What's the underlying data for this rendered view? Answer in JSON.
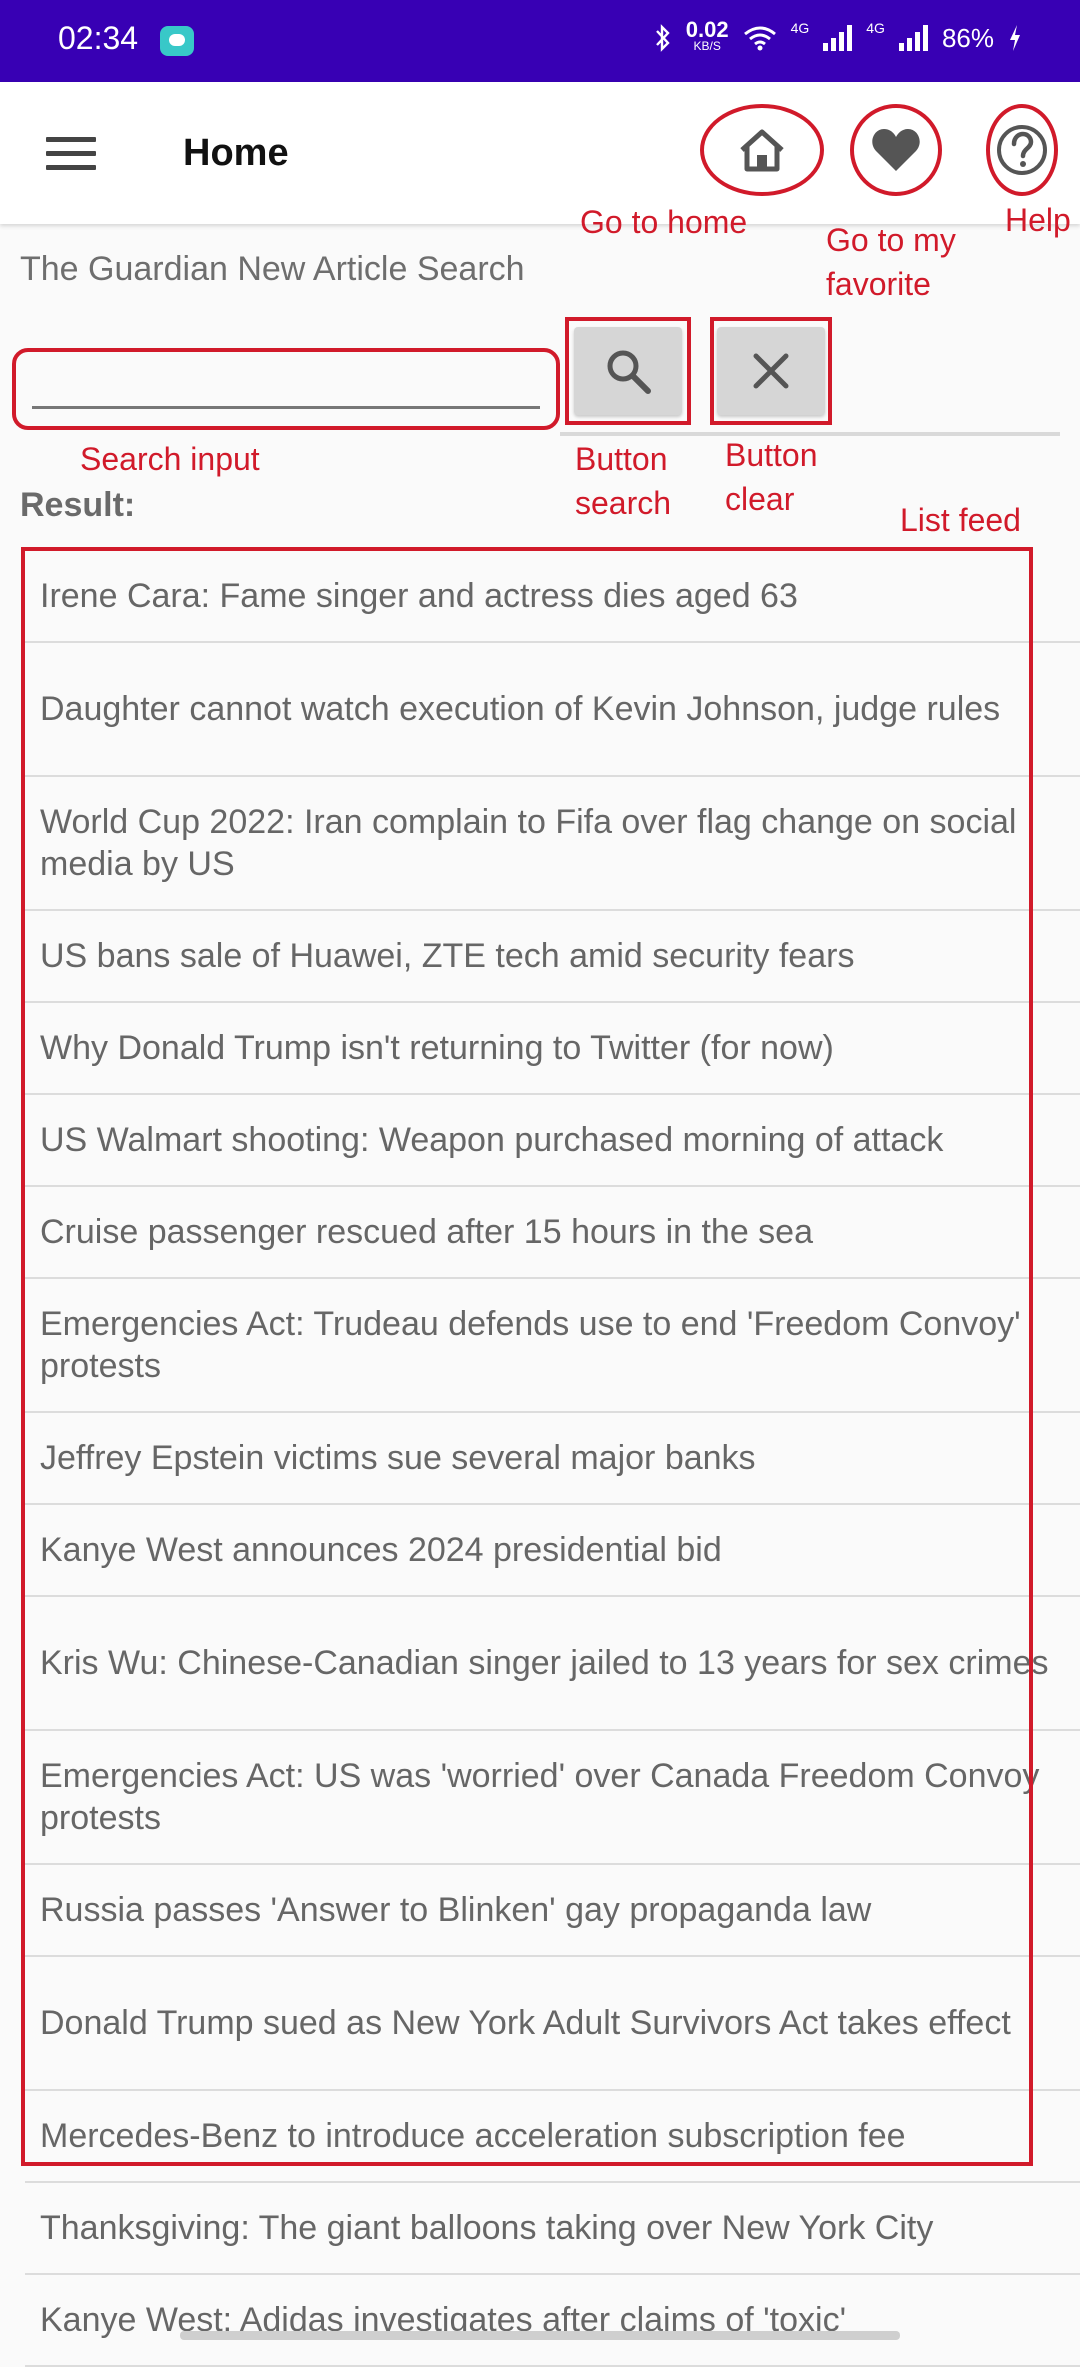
{
  "status_bar": {
    "time": "02:34",
    "speed_value": "0.02",
    "speed_unit": "KB/S",
    "net1": "4G",
    "net2": "4G",
    "battery": "86%"
  },
  "appbar": {
    "title": "Home"
  },
  "annotations": {
    "home": "Go to home",
    "favorite": "Go to my favorite",
    "help": "Help",
    "search_input": "Search input",
    "button_search": "Button search",
    "button_clear": "Button clear",
    "list_feed": "List feed"
  },
  "page": {
    "subtitle": "The Guardian New Article Search",
    "result_label": "Result:"
  },
  "search": {
    "value": "",
    "placeholder": ""
  },
  "feed": [
    "Irene Cara: Fame singer and actress dies aged 63",
    "Daughter cannot watch execution of Kevin Johnson, judge rules",
    "World Cup 2022: Iran complain to Fifa over flag change on social media by US",
    "US bans sale of Huawei, ZTE tech amid security fears",
    "Why Donald Trump isn't returning to Twitter (for now)",
    "US Walmart shooting: Weapon purchased morning of attack",
    "Cruise passenger rescued after 15 hours in the sea",
    "Emergencies Act: Trudeau defends use to end 'Freedom Convoy' protests",
    "Jeffrey Epstein victims sue several major banks",
    "Kanye West announces 2024 presidential bid",
    "Kris Wu: Chinese-Canadian singer jailed to 13 years for sex crimes",
    "Emergencies Act: US was 'worried' over Canada Freedom Convoy protests",
    "Russia passes 'Answer to Blinken' gay propaganda law",
    "Donald Trump sued as New York Adult Survivors Act takes effect",
    "Mercedes-Benz to introduce acceleration subscription fee",
    "Thanksgiving: The giant balloons taking over New York City",
    "Kanye West: Adidas investigates after claims of 'toxic'"
  ],
  "colors": {
    "status_bar": "#3800b4",
    "annotation": "#d11a2a",
    "button_bg": "#d6d6d6",
    "page_bg": "#fafafa"
  }
}
